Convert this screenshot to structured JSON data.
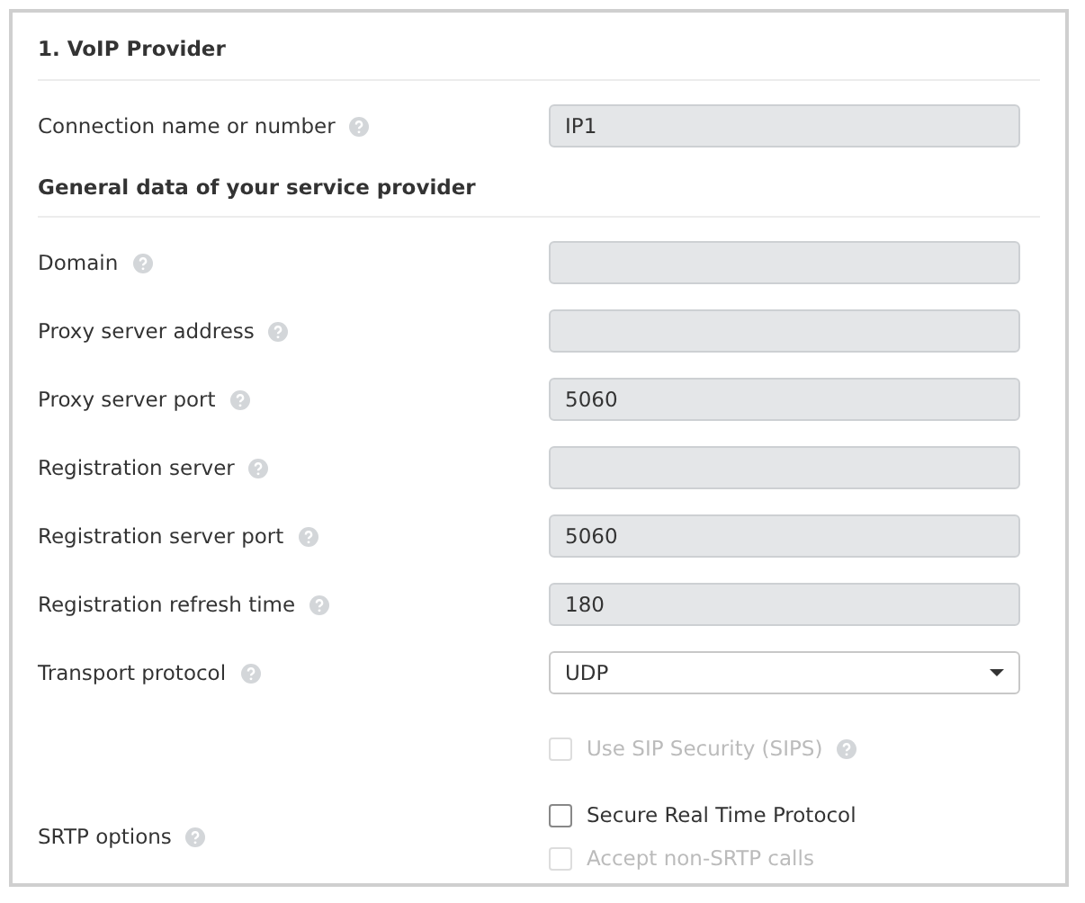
{
  "section_title": "1. VoIP Provider",
  "rows": [
    {
      "kind": "field",
      "label": "Connection name or number",
      "help": true,
      "value": "IP1",
      "disabled": true
    },
    {
      "kind": "subheading",
      "label": "General data of your service provider"
    },
    {
      "kind": "field",
      "label": "Domain",
      "help": true,
      "disabled": true
    },
    {
      "kind": "field",
      "label": "Proxy server address",
      "help": true,
      "disabled": true
    },
    {
      "kind": "field",
      "label": "Proxy server port",
      "help": true,
      "value": "5060",
      "disabled": true
    },
    {
      "kind": "field",
      "label": "Registration server",
      "help": true,
      "disabled": true
    },
    {
      "kind": "field",
      "label": "Registration server port",
      "help": true,
      "value": "5060",
      "disabled": true
    },
    {
      "kind": "field",
      "label": "Registration refresh time",
      "help": true,
      "value": "180",
      "disabled": true
    },
    {
      "kind": "select",
      "label": "Transport protocol",
      "help": true,
      "value": "UDP"
    },
    {
      "kind": "checkboxes",
      "options": [
        {
          "text": "Use SIP Security (SIPS)",
          "checked": false,
          "disabled": true,
          "help": true
        }
      ]
    },
    {
      "kind": "checkboxes",
      "label": "SRTP options",
      "help": true,
      "options": [
        {
          "text": "Secure Real Time Protocol",
          "checked": false,
          "disabled": false
        },
        {
          "text": "Accept non-SRTP calls",
          "checked": false,
          "disabled": true
        }
      ]
    }
  ]
}
